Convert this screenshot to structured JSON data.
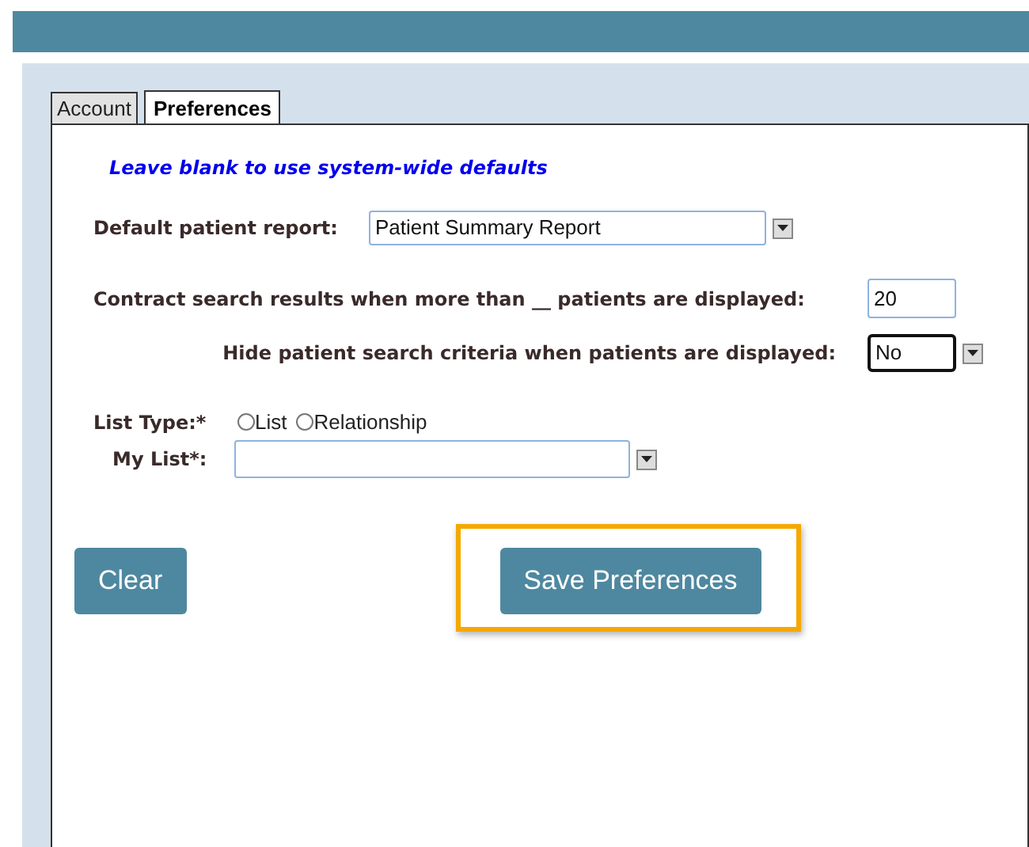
{
  "tabs": [
    {
      "label": "Account",
      "selected": false
    },
    {
      "label": "Preferences",
      "selected": true
    }
  ],
  "note": "Leave blank to use system-wide defaults",
  "default_report": {
    "label": "Default patient report:",
    "value": "Patient Summary Report"
  },
  "contract_results": {
    "label": "Contract search results when more than __ patients are displayed:",
    "value": "20"
  },
  "hide_criteria": {
    "label": "Hide patient search criteria when patients are displayed:",
    "value": "No",
    "focused": true
  },
  "list_type": {
    "label": "List Type:*",
    "options": [
      {
        "label": "List",
        "selected": false
      },
      {
        "label": "Relationship",
        "selected": false
      }
    ]
  },
  "my_list": {
    "label": "My List*:"
  },
  "buttons": [
    {
      "label": "Clear",
      "highlighted": false
    },
    {
      "label": "Save Preferences",
      "highlighted": true
    }
  ]
}
